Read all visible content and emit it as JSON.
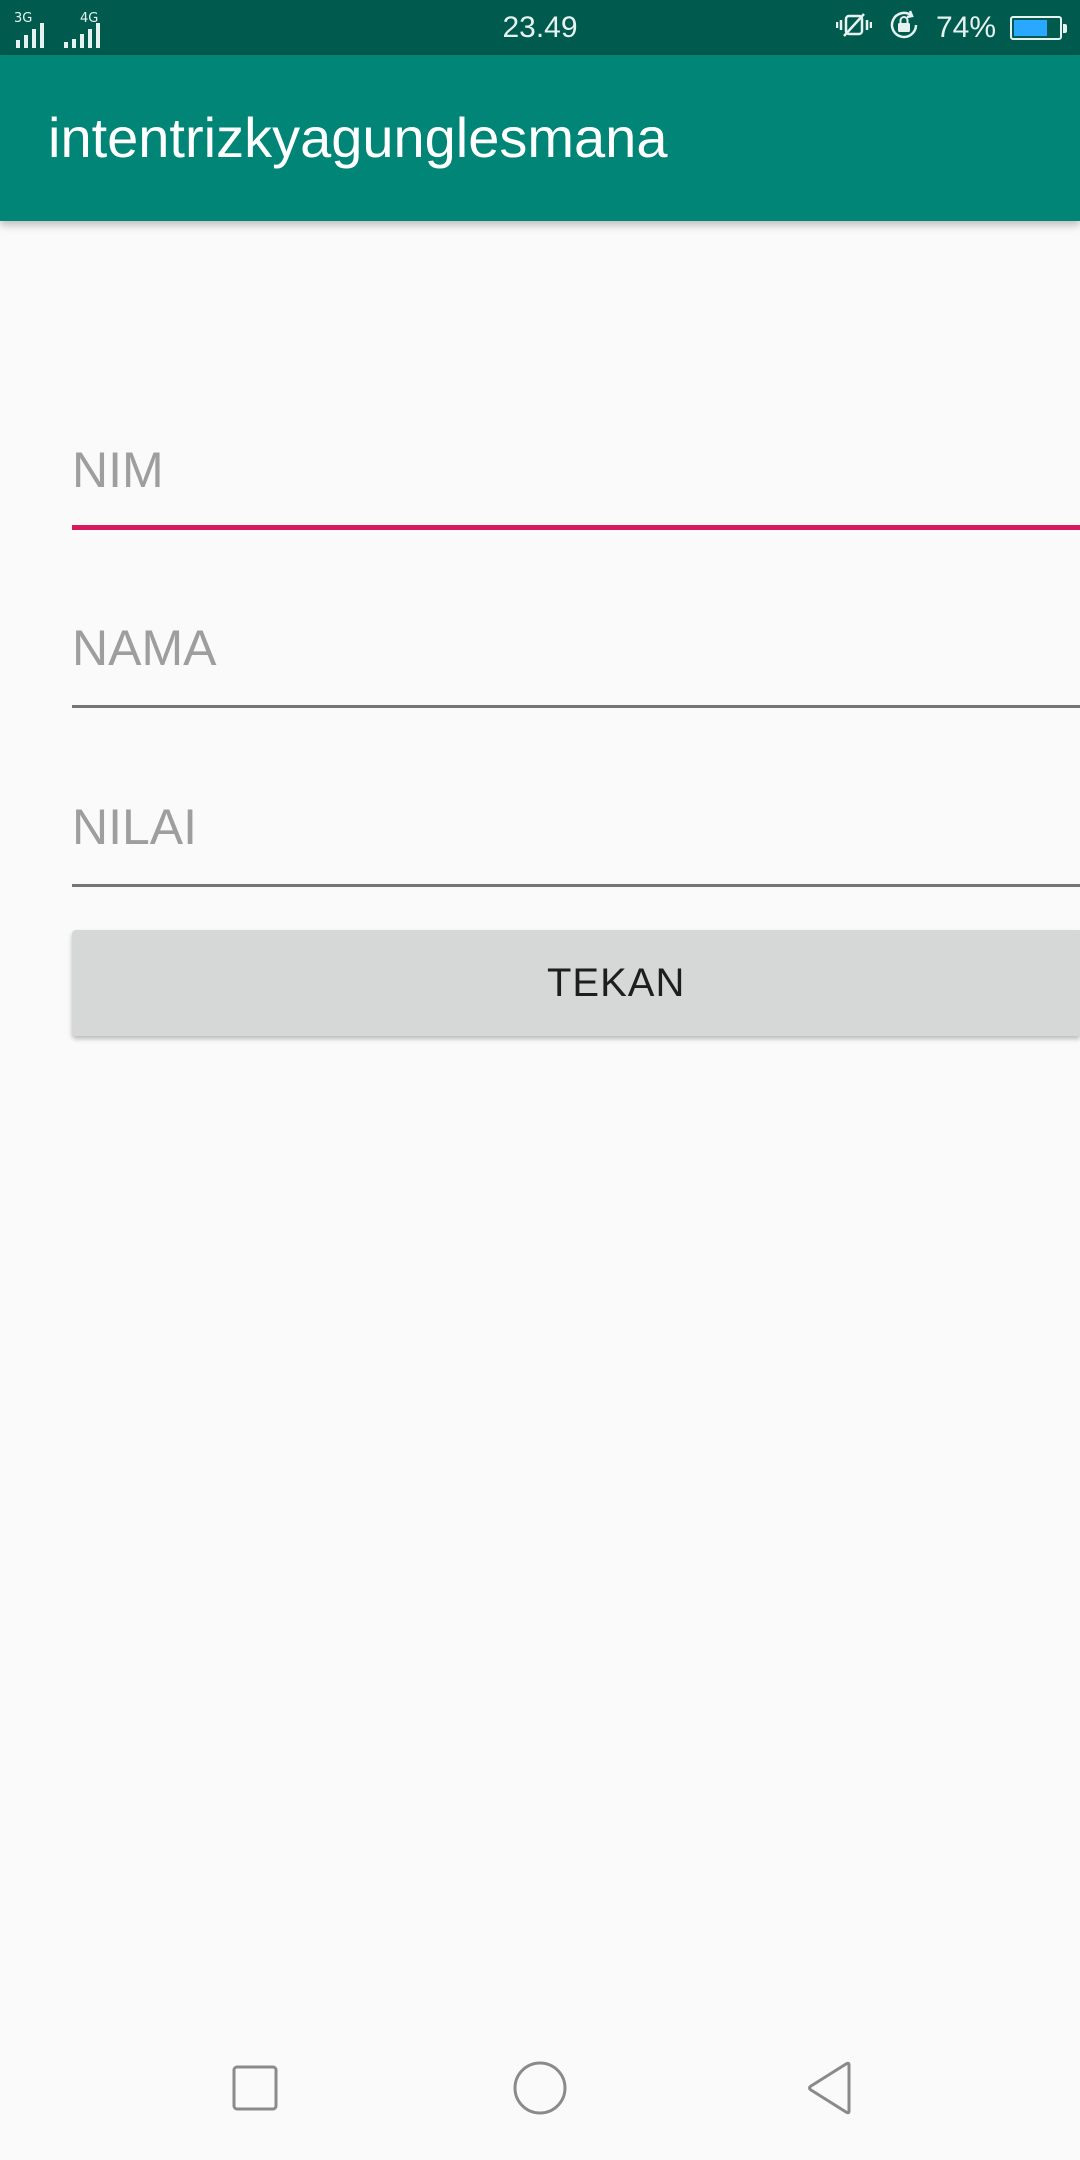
{
  "status_bar": {
    "network_1": "3G",
    "network_2": "4G",
    "time": "23.49",
    "battery_percent": "74%",
    "battery_level": 0.74,
    "icons": [
      "vibrate-icon",
      "rotation-lock-icon",
      "battery-icon"
    ]
  },
  "app_bar": {
    "title": "intentrizkyagunglesmana",
    "color": "#008577"
  },
  "form": {
    "nim_placeholder": "NIM",
    "nama_placeholder": "NAMA",
    "nilai_placeholder": "NILAI",
    "button_label": "TEKAN",
    "focus_color": "#d81b60"
  },
  "nav_bar": {
    "icons": [
      "recent-apps-icon",
      "home-icon",
      "back-icon"
    ]
  }
}
